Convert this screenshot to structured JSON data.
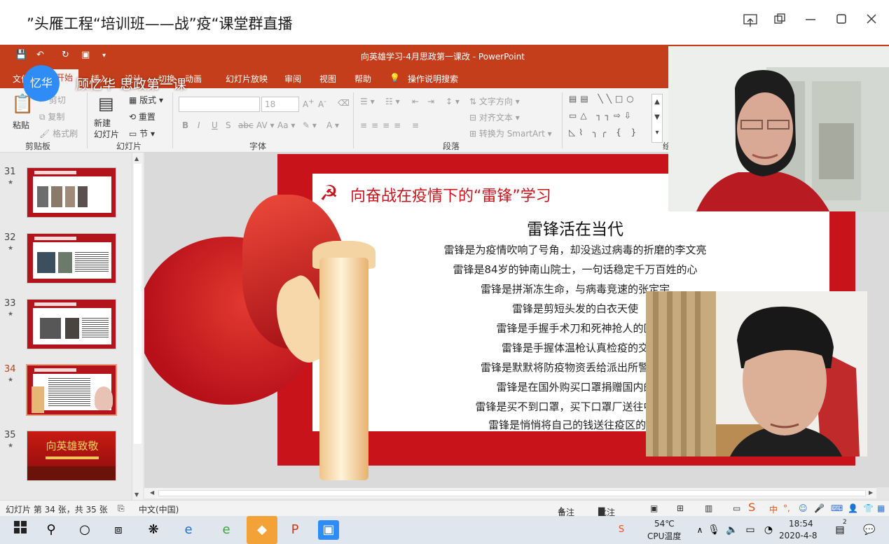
{
  "live_window": {
    "title": "”头雁工程“培训班——战”疫“课堂群直播",
    "controls": [
      "share-screen-icon",
      "restore-window-icon",
      "minimize-icon",
      "maximize-icon",
      "close-icon"
    ]
  },
  "overlay": {
    "logo_text": "忆华",
    "course_label": "顾忆华 思政第一课"
  },
  "powerpoint": {
    "doc_title": "向英雄学习-4月思政第一课改 - PowerPoint",
    "tabs": [
      "文件",
      "开始",
      "插入",
      "设计",
      "切换",
      "动画",
      "幻灯片放映",
      "审阅",
      "视图",
      "帮助",
      "操作说明搜索"
    ],
    "active_tab": "开始",
    "ribbon": {
      "clipboard": {
        "paste": "粘贴",
        "cut": "剪切",
        "copy": "复制",
        "format_painter": "格式刷",
        "group": "剪贴板"
      },
      "slides": {
        "new_slide": "新建\n幻灯片",
        "layout": "版式",
        "reset": "重置",
        "section": "节",
        "group": "幻灯片"
      },
      "font": {
        "size": "18",
        "group": "字体"
      },
      "paragraph": {
        "text_direction": "文字方向",
        "align_text": "对齐文本",
        "smartart": "转换为 SmartArt",
        "group": "段落"
      },
      "drawing_group": "绘"
    },
    "thumbnails": [
      {
        "number": "31",
        "active": false
      },
      {
        "number": "32",
        "active": false
      },
      {
        "number": "33",
        "active": false
      },
      {
        "number": "34",
        "active": true
      },
      {
        "number": "35",
        "active": false,
        "title": "向英雄致敬"
      }
    ],
    "slide": {
      "title": "向奋战在疫情下的“雷锋”学习",
      "subtitle": "雷锋活在当代",
      "lines": [
        "雷锋是为疫情吹响了号角，却没逃过病毒的折磨的李文亮",
        "雷锋是84岁的钟南山院士，一句话稳定千万百姓的心",
        "雷锋是拼渐冻生命，与病毒竞速的张定宇",
        "雷锋是剪短头发的白衣天使",
        "雷锋是手握手术刀和死神抢人的医",
        "雷锋是手握体温枪认真检疫的交",
        "雷锋是默默将防疫物资丢给派出所警察的",
        "雷锋是在国外购买口罩捐赠国内的",
        "雷锋是买不到口罩，买下口罩厂送往中国的",
        "雷锋是悄悄将自己的钱送往疫区的“拾"
      ]
    },
    "statusbar": {
      "slide_info": "幻灯片 第 34 张，共 35 张",
      "language": "中文(中国)",
      "notes": "备注",
      "comments": "批注"
    }
  },
  "taskbar": {
    "temperature": "54℃",
    "cpu_label": "CPU温度",
    "time": "18:54",
    "date": "2020-4-8",
    "ime": "中",
    "notification_count": "2"
  },
  "colors": {
    "ppt_accent": "#c43e1c",
    "slide_red": "#c8131b",
    "logo_blue": "#2f8cf6"
  }
}
